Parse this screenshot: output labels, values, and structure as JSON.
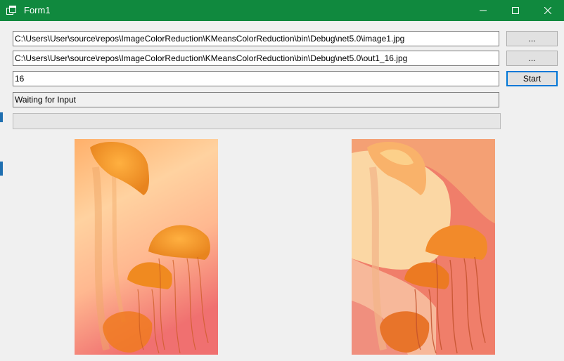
{
  "window": {
    "title": "Form1"
  },
  "form": {
    "input_path": "C:\\Users\\User\\source\\repos\\ImageColorReduction\\KMeansColorReduction\\bin\\Debug\\net5.0\\image1.jpg",
    "output_path": "C:\\Users\\User\\source\\repos\\ImageColorReduction\\KMeansColorReduction\\bin\\Debug\\net5.0\\out1_16.jpg",
    "color_count": "16",
    "status": "Waiting for Input",
    "browse_input_label": "...",
    "browse_output_label": "...",
    "start_label": "Start",
    "progress": 0
  },
  "icons": {
    "app": "window-app-icon",
    "minimize": "minimize-icon",
    "maximize": "maximize-icon",
    "close": "close-icon"
  },
  "colors": {
    "titlebar": "#10893e",
    "accent": "#0078d7"
  }
}
